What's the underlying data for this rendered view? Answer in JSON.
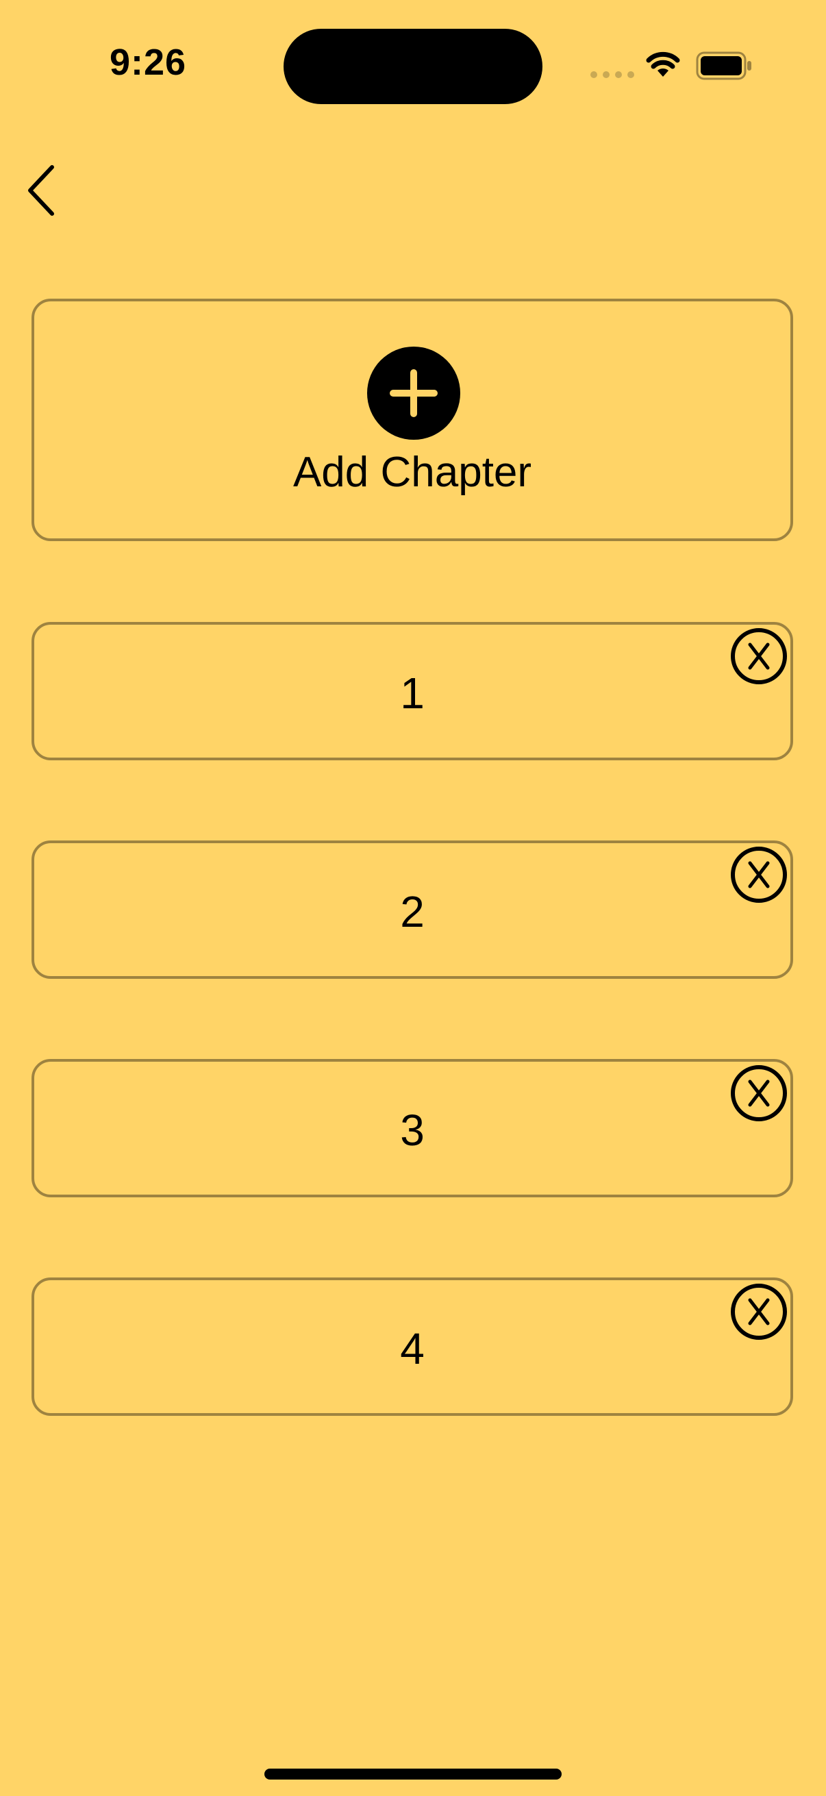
{
  "status_bar": {
    "time": "9:26"
  },
  "nav": {
    "back_icon": "chevron-left-icon"
  },
  "add_chapter": {
    "label": "Add Chapter",
    "icon": "plus-circle-icon"
  },
  "chapters": [
    {
      "label": "1"
    },
    {
      "label": "2"
    },
    {
      "label": "3"
    },
    {
      "label": "4"
    }
  ],
  "delete_icon": "x-circle-icon",
  "colors": {
    "background": "#FFD467",
    "card_border": "#9E8340",
    "foreground": "#000000"
  }
}
